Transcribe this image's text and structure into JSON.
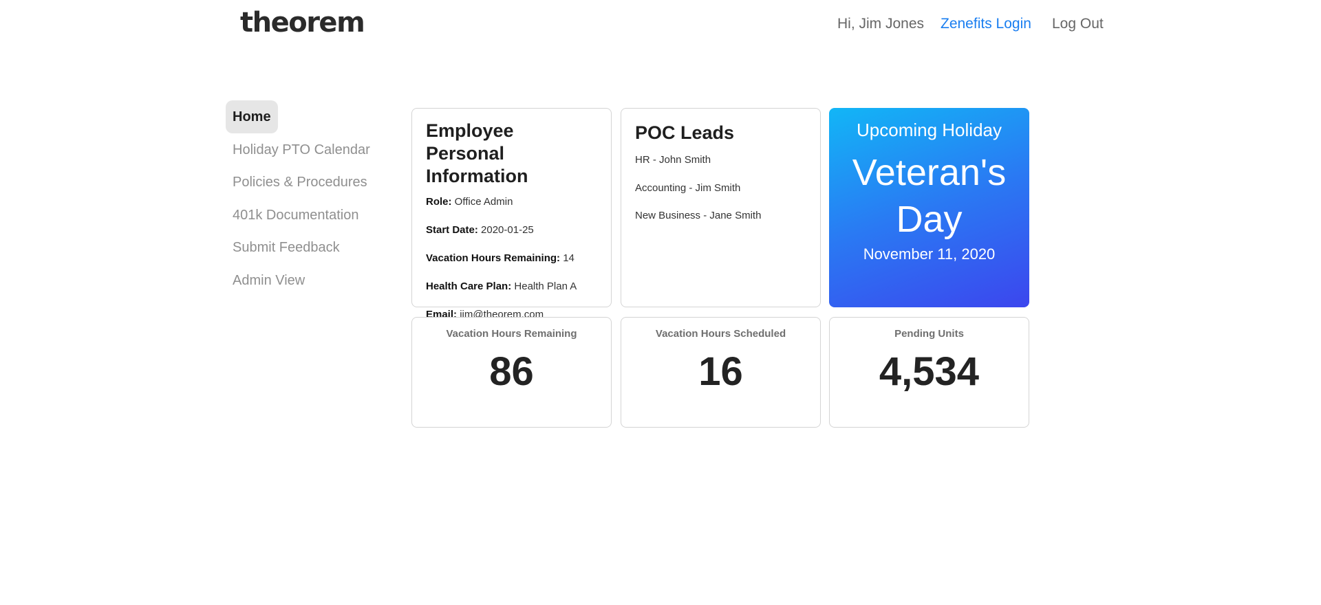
{
  "header": {
    "logo": "theorem",
    "greeting": "Hi, Jim Jones",
    "zenefits_label": "Zenefits Login",
    "logout_label": "Log Out"
  },
  "sidebar": {
    "items": [
      {
        "label": "Home",
        "active": true
      },
      {
        "label": "Holiday PTO Calendar"
      },
      {
        "label": "Policies & Procedures"
      },
      {
        "label": "401k Documentation"
      },
      {
        "label": "Submit Feedback"
      },
      {
        "label": "Admin View"
      }
    ]
  },
  "employee_info": {
    "title": "Employee Personal Information",
    "fields": [
      {
        "label": "Role:",
        "value": "Office Admin"
      },
      {
        "label": "Start Date:",
        "value": "2020-01-25"
      },
      {
        "label": "Vacation Hours Remaining:",
        "value": "14"
      },
      {
        "label": "Health Care Plan:",
        "value": "Health Plan A"
      },
      {
        "label": "Email:",
        "value": "jim@theorem.com"
      }
    ]
  },
  "poc_leads": {
    "title": "POC Leads",
    "items": [
      "HR - John Smith",
      "Accounting - Jim Smith",
      "New Business - Jane Smith"
    ]
  },
  "holiday": {
    "label": "Upcoming Holiday",
    "name": "Veteran's Day",
    "date": "November 11, 2020"
  },
  "stats": [
    {
      "label": "Vacation Hours Remaining",
      "value": "86"
    },
    {
      "label": "Vacation Hours Scheduled",
      "value": "16"
    },
    {
      "label": "Pending Units",
      "value": "4,534"
    }
  ],
  "colors": {
    "accent_link": "#1a7ef0",
    "holiday_gradient_start": "#12b6f6",
    "holiday_gradient_end": "#3c46ee"
  }
}
